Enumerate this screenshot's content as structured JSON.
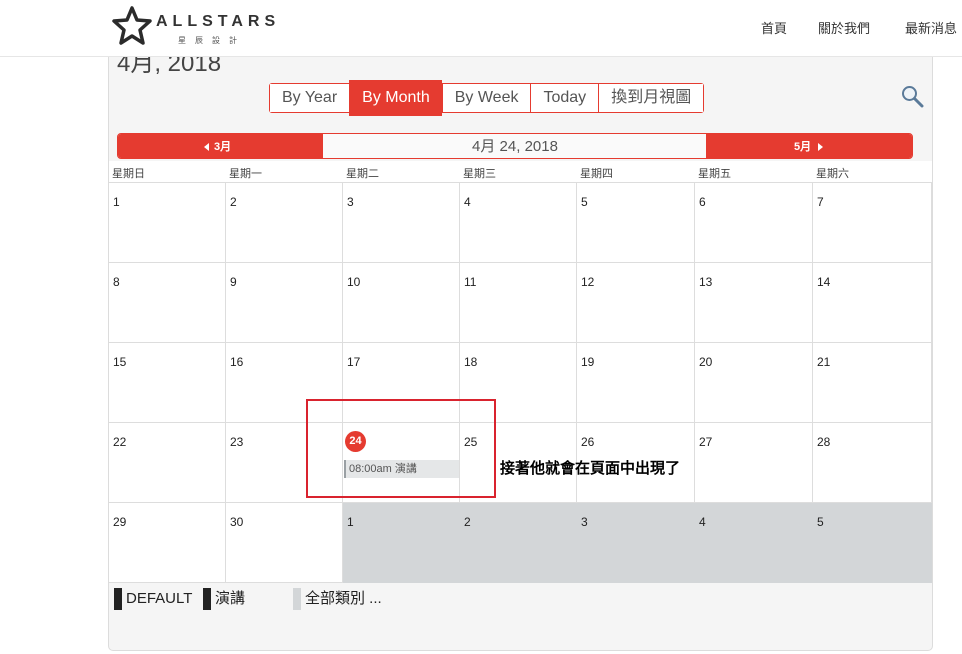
{
  "logo": {
    "name": "ALLSTARS",
    "sub": "星辰設計"
  },
  "nav": [
    {
      "label": "首頁"
    },
    {
      "label": "關於我們"
    },
    {
      "label": "最新消息"
    }
  ],
  "calendar": {
    "heading": "4月, 2018",
    "views": [
      {
        "label": "By Year",
        "active": false
      },
      {
        "label": "By Month",
        "active": true
      },
      {
        "label": "By Week",
        "active": false
      },
      {
        "label": "Today",
        "active": false
      },
      {
        "label": "換到月視圖",
        "active": false
      }
    ],
    "prev_month": "3月",
    "current_date": "4月 24, 2018",
    "next_month": "5月",
    "weekdays": [
      "星期日",
      "星期一",
      "星期二",
      "星期三",
      "星期四",
      "星期五",
      "星期六"
    ],
    "weeks": [
      [
        "1",
        "2",
        "3",
        "4",
        "5",
        "6",
        "7"
      ],
      [
        "8",
        "9",
        "10",
        "11",
        "12",
        "13",
        "14"
      ],
      [
        "15",
        "16",
        "17",
        "18",
        "19",
        "20",
        "21"
      ],
      [
        "22",
        "23",
        "24",
        "25",
        "26",
        "27",
        "28"
      ],
      [
        "29",
        "30",
        "1",
        "2",
        "3",
        "4",
        "5"
      ]
    ],
    "other_month_cells": [
      [
        4,
        2
      ],
      [
        4,
        3
      ],
      [
        4,
        4
      ],
      [
        4,
        5
      ],
      [
        4,
        6
      ]
    ],
    "today_cell": [
      3,
      2
    ],
    "events": [
      {
        "week": 3,
        "day": 2,
        "label": "08:00am 演講"
      }
    ],
    "legend": [
      {
        "label": "DEFAULT",
        "color": "#222222"
      },
      {
        "label": "演講",
        "color": "#222222"
      },
      {
        "label": "全部類別 ...",
        "color": "#d3d6d8"
      }
    ]
  },
  "annotation": {
    "text": "接著他就會在頁面中出現了"
  },
  "colors": {
    "accent": "#e53b30",
    "annotation_border": "#d9232e",
    "other_month_bg": "#d3d6d8"
  }
}
